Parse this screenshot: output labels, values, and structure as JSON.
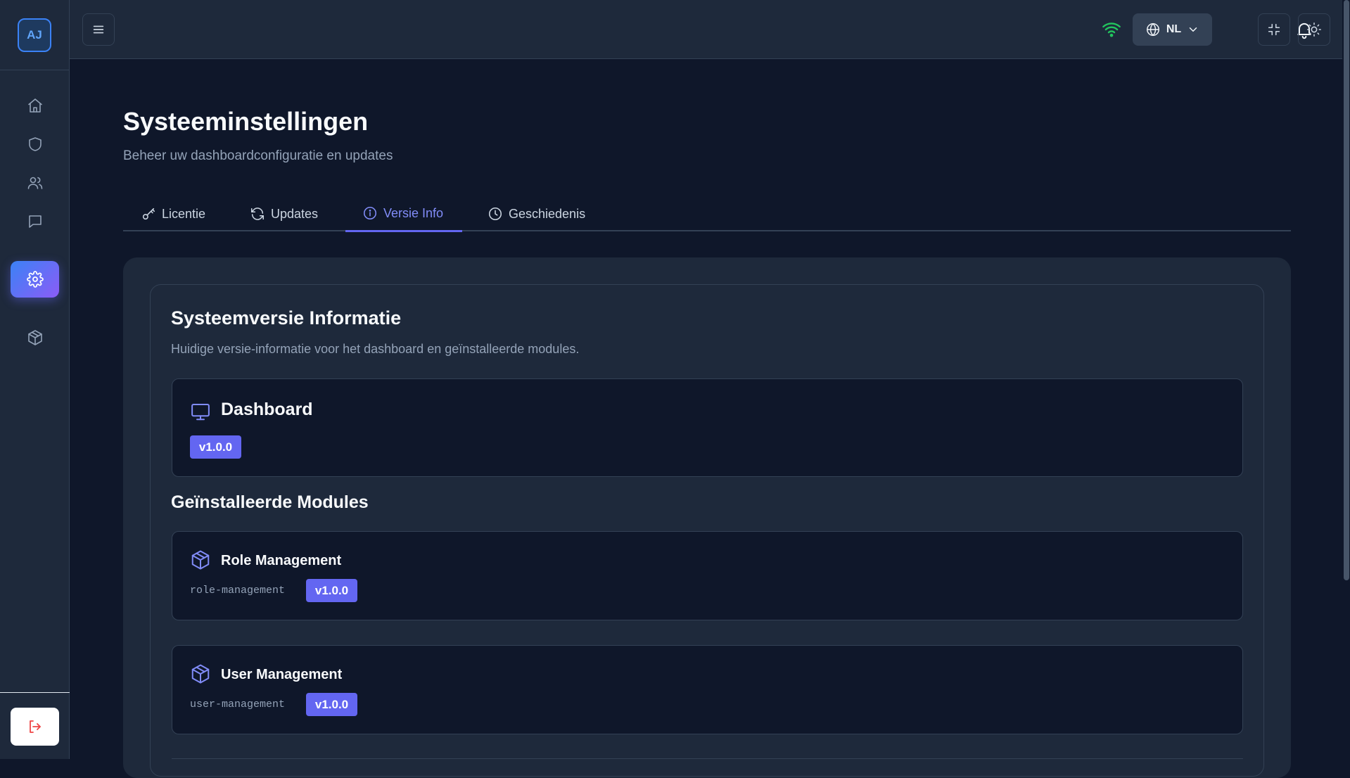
{
  "user": {
    "initials": "AJ"
  },
  "header": {
    "language": "NL"
  },
  "page": {
    "title": "Systeeminstellingen",
    "subtitle": "Beheer uw dashboardconfiguratie en updates"
  },
  "tabs": [
    {
      "label": "Licentie",
      "icon": "key-icon"
    },
    {
      "label": "Updates",
      "icon": "refresh-icon"
    },
    {
      "label": "Versie Info",
      "icon": "info-icon",
      "active": true
    },
    {
      "label": "Geschiedenis",
      "icon": "clock-icon"
    }
  ],
  "version_info": {
    "title": "Systeemversie Informatie",
    "description": "Huidige versie-informatie voor het dashboard en geïnstalleerde modules.",
    "dashboard": {
      "name": "Dashboard",
      "version": "v1.0.0"
    },
    "modules_title": "Geïnstalleerde Modules",
    "modules": [
      {
        "name": "Role Management",
        "id": "role-management",
        "version": "v1.0.0"
      },
      {
        "name": "User Management",
        "id": "user-management",
        "version": "v1.0.0"
      }
    ]
  },
  "colors": {
    "background": "#0f172a",
    "surface": "#1e293b",
    "accent": "#6366f1",
    "online": "#22c55e",
    "logout": "#ef4444"
  }
}
